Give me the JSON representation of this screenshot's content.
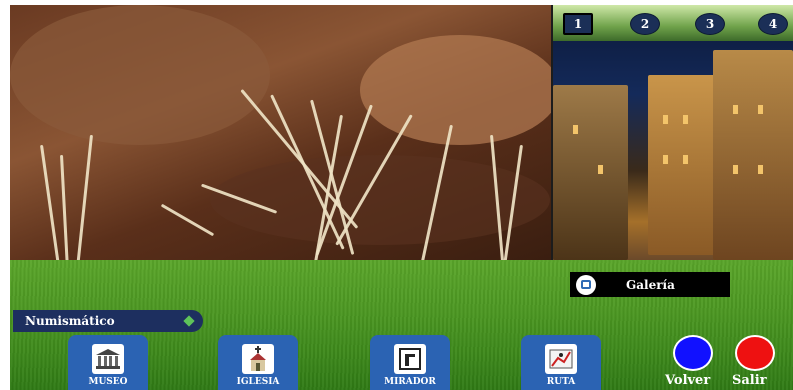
{
  "photo_tabs": [
    "1",
    "2",
    "3",
    "4"
  ],
  "galeria": {
    "label": "Galería",
    "icon": "gallery-icon"
  },
  "numismatico": {
    "label": "Numismático",
    "icon": "diamond-icon"
  },
  "nav": [
    {
      "label": "MUSEO",
      "icon": "museum-icon"
    },
    {
      "label": "IGLESIA",
      "icon": "church-icon"
    },
    {
      "label": "MIRADOR",
      "icon": "viewpoint-icon"
    },
    {
      "label": "RUTA",
      "icon": "route-icon"
    }
  ],
  "actions": {
    "volver": {
      "label": "Volver",
      "color": "#1111ff"
    },
    "salir": {
      "label": "Salir",
      "color": "#ee1111"
    }
  }
}
